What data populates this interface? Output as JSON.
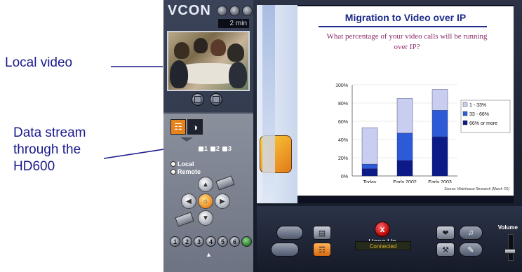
{
  "callouts": {
    "local_video": "Local video",
    "data_stream": [
      "Data stream",
      "through the",
      "HD600"
    ]
  },
  "app": {
    "brand": "VCON",
    "timer": "2 min",
    "camera_select": [
      "1",
      "2",
      "3"
    ],
    "camera_mode": [
      "Local",
      "Remote"
    ],
    "presets": [
      "1",
      "2",
      "3",
      "4",
      "5",
      "6"
    ],
    "hangup_label": "Hang Up",
    "status": "Connected",
    "volume_label": "Volume",
    "volume_level": 0.3
  },
  "slide": {
    "title": "Migration to Video over IP",
    "question": "What percentage of your video calls will be running over IP?",
    "source": "Source: Wainhouse Research (March '01)"
  },
  "chart_data": {
    "type": "bar",
    "stacked": true,
    "categories": [
      "Today",
      "Early 2002",
      "Early 2003"
    ],
    "series": [
      {
        "name": "66% or more",
        "values": [
          8,
          17,
          43
        ],
        "color": "#0b1a86"
      },
      {
        "name": "33 - 66%",
        "values": [
          5,
          30,
          29
        ],
        "color": "#2d5bd7"
      },
      {
        "name": "1 - 33%",
        "values": [
          40,
          38,
          23
        ],
        "color": "#c9cef0"
      }
    ],
    "ylim": [
      0,
      100
    ],
    "yticks": [
      "0%",
      "20%",
      "40%",
      "60%",
      "80%",
      "100%"
    ],
    "grid": true,
    "legend": "right"
  },
  "icons": {
    "brand_buttons": [
      "help-icon",
      "minimize-icon",
      "close-icon"
    ],
    "bottom": [
      "phone-icon",
      "document-icon",
      "camera-icon",
      "share-icon",
      "tools-icon",
      "speaker-icon",
      "mic-icon"
    ]
  }
}
